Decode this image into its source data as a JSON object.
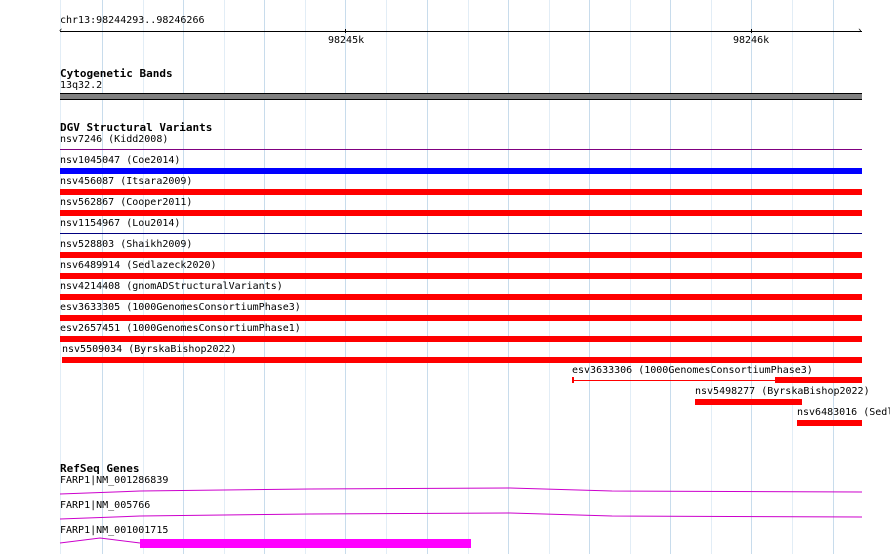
{
  "ruler": {
    "location": "chr13:98244293..98246266",
    "tick_1": "98245k",
    "tick_2": "98246k"
  },
  "cytoband": {
    "title": "Cytogenetic Bands",
    "band": "13q32.2",
    "color": "#808080"
  },
  "dgv": {
    "title": "DGV Structural Variants",
    "items": [
      {
        "label": "nsv7246 (Kidd2008)",
        "color": "#800080"
      },
      {
        "label": "nsv1045047 (Coe2014)",
        "color": "#0000ff"
      },
      {
        "label": "nsv456087 (Itsara2009)",
        "color": "#ff0000"
      },
      {
        "label": "nsv562867 (Cooper2011)",
        "color": "#ff0000"
      },
      {
        "label": "nsv1154967 (Lou2014)",
        "color": "#000080"
      },
      {
        "label": "nsv528803 (Shaikh2009)",
        "color": "#ff0000"
      },
      {
        "label": "nsv6489914 (Sedlazeck2020)",
        "color": "#ff0000"
      },
      {
        "label": "nsv4214408 (gnomADStructuralVariants)",
        "color": "#ff0000"
      },
      {
        "label": "esv3633305 (1000GenomesConsortiumPhase3)",
        "color": "#ff0000"
      },
      {
        "label": "esv2657451 (1000GenomesConsortiumPhase1)",
        "color": "#ff0000"
      },
      {
        "label": "nsv5509034 (ByrskaBishop2022)",
        "color": "#ff0000"
      },
      {
        "label": "esv3633306 (1000GenomesConsortiumPhase3)",
        "color": "#ff0000"
      },
      {
        "label": "nsv5498277 (ByrskaBishop2022)",
        "color": "#ff0000"
      },
      {
        "label": "nsv6483016 (Sedl",
        "color": "#ff0000"
      }
    ]
  },
  "refseq": {
    "title": "RefSeq Genes",
    "genes": [
      {
        "label": "FARP1|NM_001286839",
        "color": "#cc00cc"
      },
      {
        "label": "FARP1|NM_005766",
        "color": "#cc00cc"
      },
      {
        "label": "FARP1|NM_001001715",
        "color": "#cc00cc"
      }
    ]
  }
}
